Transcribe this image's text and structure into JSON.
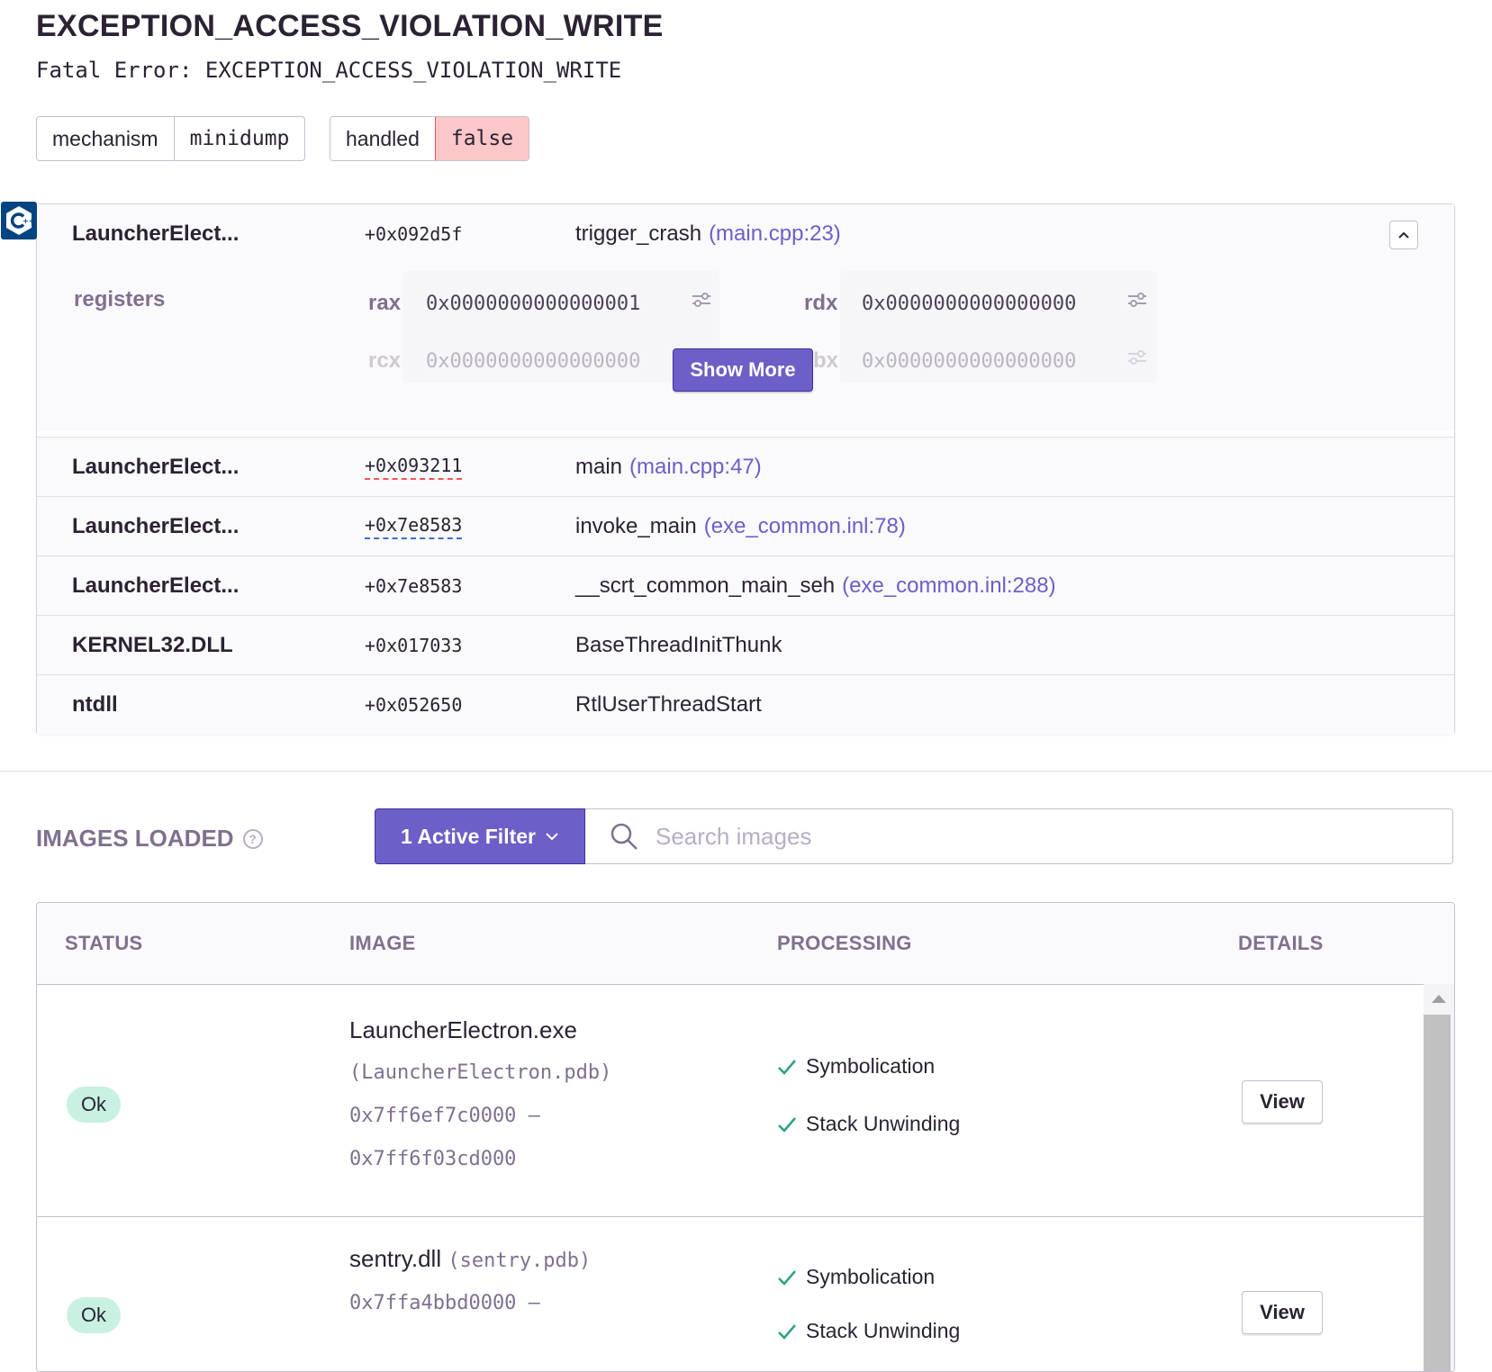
{
  "header": {
    "title": "EXCEPTION_ACCESS_VIOLATION_WRITE",
    "subtitle": "Fatal Error: EXCEPTION_ACCESS_VIOLATION_WRITE"
  },
  "tags": [
    {
      "key": "mechanism",
      "value": "minidump"
    },
    {
      "key": "handled",
      "value": "false"
    }
  ],
  "platform_icon": "cpp-icon",
  "frames": [
    {
      "package": "LauncherElect...",
      "address": "+0x092d5f",
      "function": "trigger_crash",
      "file": "(main.cpp:23)"
    },
    {
      "package": "LauncherElect...",
      "address": "+0x093211",
      "function": "main",
      "file": "(main.cpp:47)"
    },
    {
      "package": "LauncherElect...",
      "address": "+0x7e8583",
      "function": "invoke_main",
      "file": "(exe_common.inl:78)"
    },
    {
      "package": "LauncherElect...",
      "address": "+0x7e8583",
      "function": "__scrt_common_main_seh",
      "file": "(exe_common.inl:288)"
    },
    {
      "package": "KERNEL32.DLL",
      "address": "+0x017033",
      "function": "BaseThreadInitThunk",
      "file": ""
    },
    {
      "package": "ntdll",
      "address": "+0x052650",
      "function": "RtlUserThreadStart",
      "file": ""
    }
  ],
  "registers": {
    "title": "registers",
    "items": [
      {
        "name": "rax",
        "value": "0x0000000000000001"
      },
      {
        "name": "rdx",
        "value": "0x0000000000000000"
      },
      {
        "name": "rcx",
        "value": "0x0000000000000000"
      },
      {
        "name": "bx",
        "value": "0x0000000000000000"
      }
    ],
    "show_more_label": "Show More"
  },
  "images": {
    "title": "IMAGES LOADED",
    "filter_label": "1 Active Filter",
    "search_placeholder": "Search images",
    "columns": [
      "STATUS",
      "IMAGE",
      "PROCESSING",
      "DETAILS"
    ],
    "rows": [
      {
        "status": "Ok",
        "name": "LauncherElectron.exe",
        "debug_file": "(LauncherElectron.pdb)",
        "address_start": "0x7ff6ef7c0000 –",
        "address_end": "0x7ff6f03cd000",
        "processing": [
          "Symbolication",
          "Stack Unwinding"
        ],
        "action": "View"
      },
      {
        "status": "Ok",
        "name": "sentry.dll",
        "debug_file": "(sentry.pdb)",
        "address_start": "0x7ffa4bbd0000 –",
        "processing": [
          "Symbolication",
          "Stack Unwinding"
        ],
        "action": "View"
      }
    ]
  },
  "colors": {
    "accent": "#6c5fc7",
    "danger_bg": "#fbc7c9",
    "ok_bg": "#c8f1e1",
    "check": "#2ba185"
  }
}
